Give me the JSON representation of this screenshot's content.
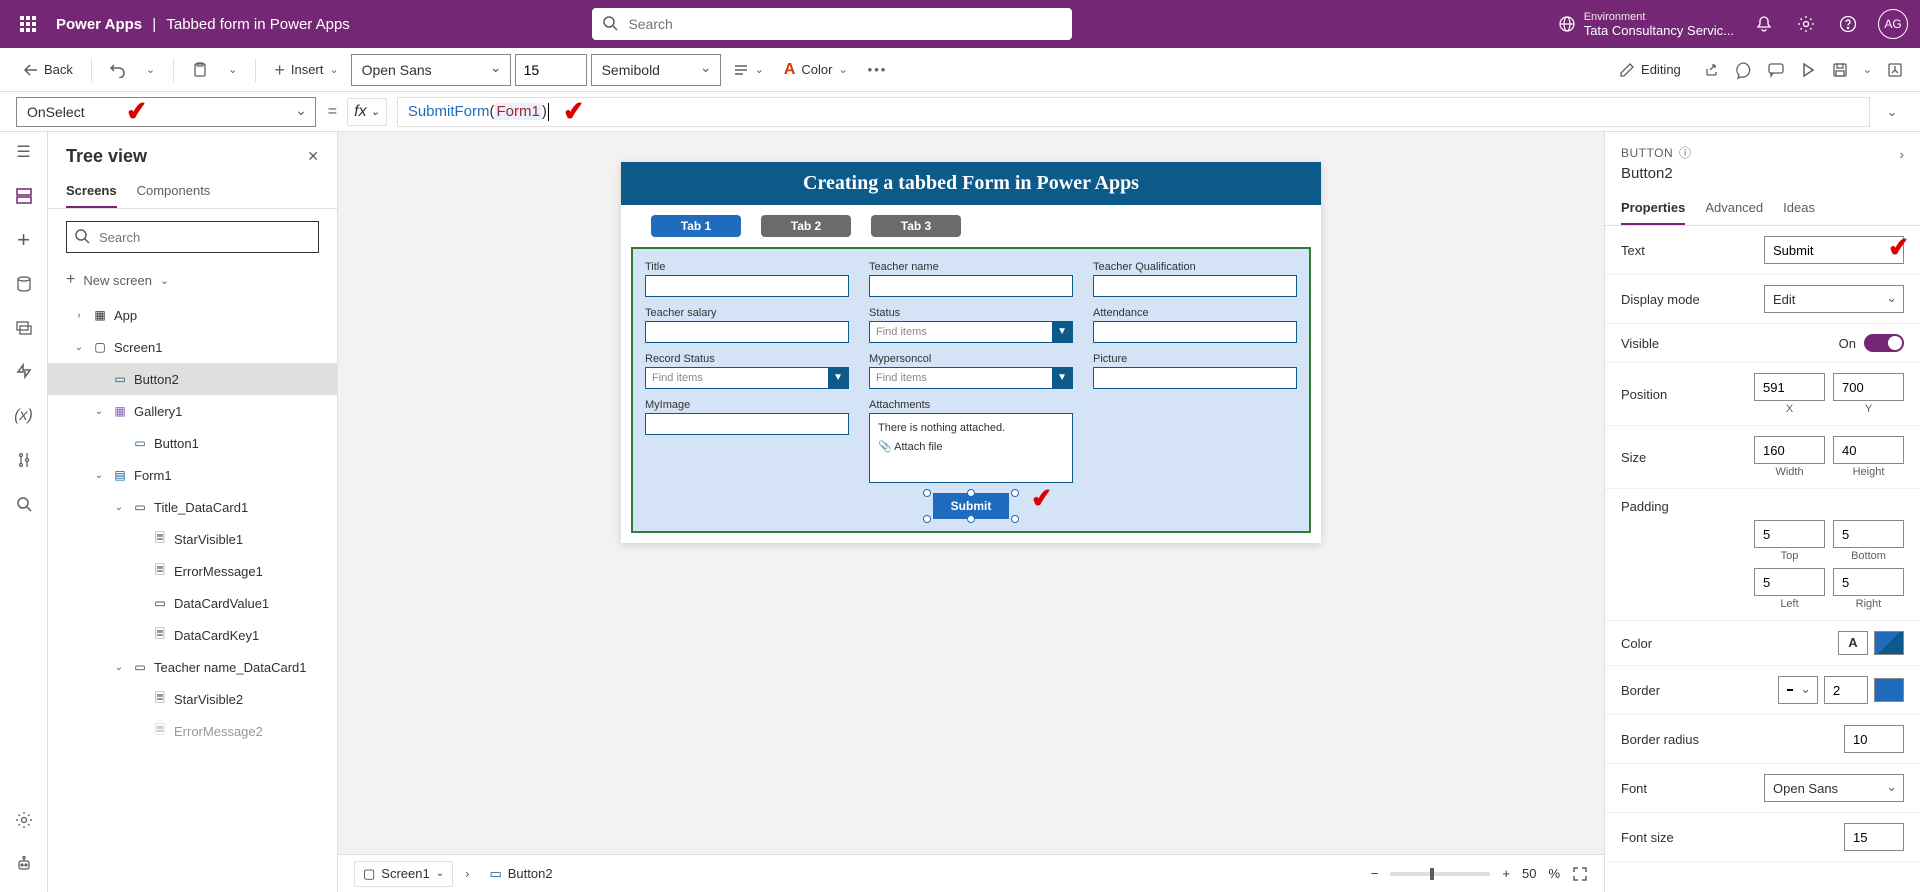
{
  "header": {
    "app": "Power Apps",
    "file": "Tabbed form in Power Apps",
    "search_placeholder": "Search",
    "env_label": "Environment",
    "env_name": "Tata Consultancy Servic...",
    "avatar": "AG"
  },
  "toolbar": {
    "back": "Back",
    "insert": "Insert",
    "font": "Open Sans",
    "font_size": "15",
    "weight": "Semibold",
    "color": "Color",
    "editing": "Editing"
  },
  "formula": {
    "property": "OnSelect",
    "fn": "SubmitForm",
    "arg": "Form1"
  },
  "tree": {
    "title": "Tree view",
    "tab_screens": "Screens",
    "tab_components": "Components",
    "search_placeholder": "Search",
    "new_screen": "New screen",
    "items": {
      "app": "App",
      "screen1": "Screen1",
      "button2": "Button2",
      "gallery1": "Gallery1",
      "button1": "Button1",
      "form1": "Form1",
      "title_dc": "Title_DataCard1",
      "star1": "StarVisible1",
      "err1": "ErrorMessage1",
      "dcval1": "DataCardValue1",
      "dckey1": "DataCardKey1",
      "teacher_dc": "Teacher name_DataCard1",
      "star2": "StarVisible2",
      "err2": "ErrorMessage2"
    }
  },
  "canvas": {
    "title": "Creating a tabbed Form in Power Apps",
    "tab1": "Tab 1",
    "tab2": "Tab 2",
    "tab3": "Tab 3",
    "f_title": "Title",
    "f_teacher_name": "Teacher name",
    "f_teacher_qual": "Teacher Qualification",
    "f_salary": "Teacher salary",
    "f_status": "Status",
    "f_attendance": "Attendance",
    "f_record_status": "Record Status",
    "f_personcol": "Mypersoncol",
    "f_picture": "Picture",
    "f_myimage": "MyImage",
    "f_attachments": "Attachments",
    "find_items": "Find items",
    "no_attach": "There is nothing attached.",
    "attach_file": "Attach file",
    "submit": "Submit"
  },
  "status": {
    "screen": "Screen1",
    "button": "Button2",
    "zoom": "50",
    "pct": "%"
  },
  "props": {
    "type": "BUTTON",
    "name": "Button2",
    "tab_properties": "Properties",
    "tab_advanced": "Advanced",
    "tab_ideas": "Ideas",
    "text_label": "Text",
    "text_val": "Submit",
    "display_mode_label": "Display mode",
    "display_mode_val": "Edit",
    "visible_label": "Visible",
    "visible_val": "On",
    "position_label": "Position",
    "pos_x": "591",
    "pos_y": "700",
    "lbl_x": "X",
    "lbl_y": "Y",
    "size_label": "Size",
    "size_w": "160",
    "size_h": "40",
    "lbl_w": "Width",
    "lbl_h": "Height",
    "padding_label": "Padding",
    "pad_t": "5",
    "pad_b": "5",
    "pad_l": "5",
    "pad_r": "5",
    "lbl_t": "Top",
    "lbl_bt": "Bottom",
    "lbl_l": "Left",
    "lbl_r": "Right",
    "color_label": "Color",
    "border_label": "Border",
    "border_val": "2",
    "border_radius_label": "Border radius",
    "border_radius_val": "10",
    "font_label": "Font",
    "font_val": "Open Sans",
    "font_size_label": "Font size",
    "font_size_val": "15"
  }
}
